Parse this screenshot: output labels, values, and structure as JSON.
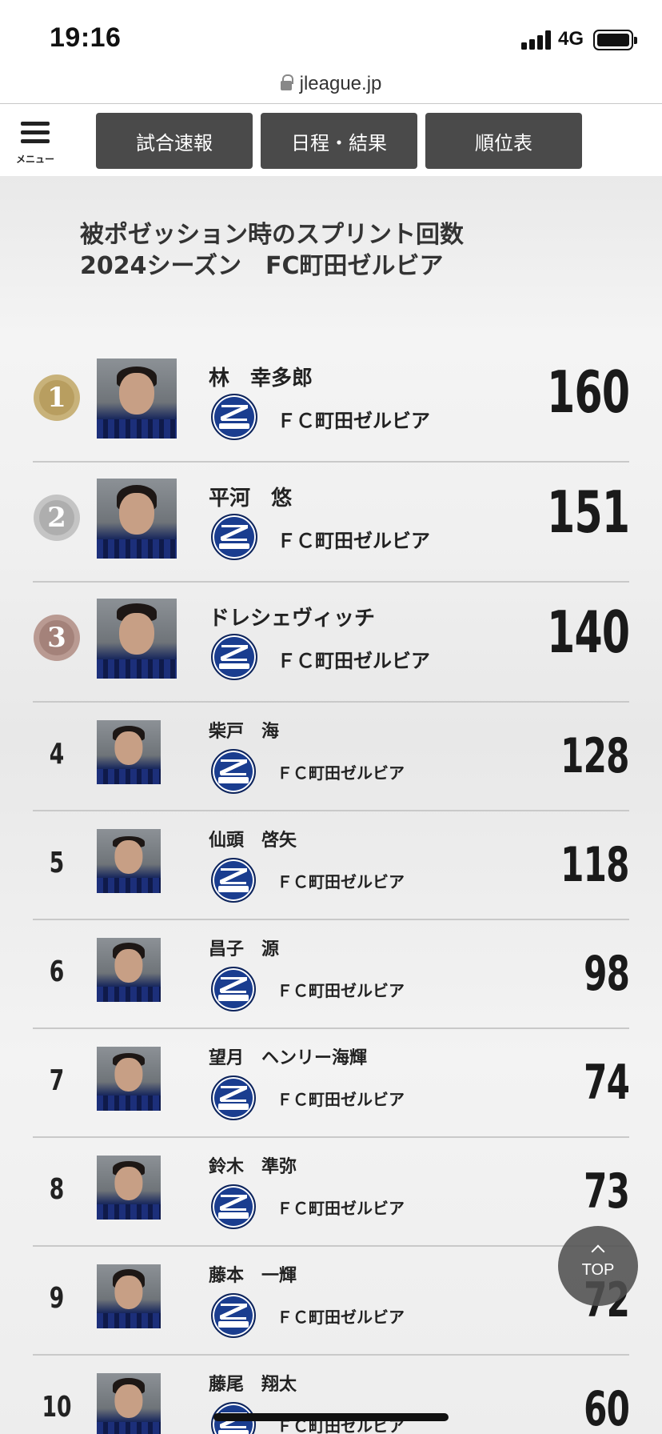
{
  "status_bar": {
    "time": "19:16",
    "network": "4G",
    "url": "jleague.jp"
  },
  "nav": {
    "menu_label": "メニュー",
    "tabs": [
      "試合速報",
      "日程・結果",
      "順位表"
    ]
  },
  "page": {
    "title_line1": "被ポゼッション時のスプリント回数",
    "title_line2": "2024シーズン　FC町田ゼルビア"
  },
  "rankings": [
    {
      "rank": "1",
      "name": "林　幸多郎",
      "club": "ＦＣ町田ゼルビア",
      "value": "160"
    },
    {
      "rank": "2",
      "name": "平河　悠",
      "club": "ＦＣ町田ゼルビア",
      "value": "151"
    },
    {
      "rank": "3",
      "name": "ドレシェヴィッチ",
      "club": "ＦＣ町田ゼルビア",
      "value": "140"
    },
    {
      "rank": "4",
      "name": "柴戸　海",
      "club": "ＦＣ町田ゼルビア",
      "value": "128"
    },
    {
      "rank": "5",
      "name": "仙頭　啓矢",
      "club": "ＦＣ町田ゼルビア",
      "value": "118"
    },
    {
      "rank": "6",
      "name": "昌子　源",
      "club": "ＦＣ町田ゼルビア",
      "value": "98"
    },
    {
      "rank": "7",
      "name": "望月　ヘンリー海輝",
      "club": "ＦＣ町田ゼルビア",
      "value": "74"
    },
    {
      "rank": "8",
      "name": "鈴木　準弥",
      "club": "ＦＣ町田ゼルビア",
      "value": "73"
    },
    {
      "rank": "9",
      "name": "藤本　一輝",
      "club": "ＦＣ町田ゼルビア",
      "value": "72"
    },
    {
      "rank": "10",
      "name": "藤尾　翔太",
      "club": "ＦＣ町田ゼルビア",
      "value": "60"
    }
  ],
  "top_button": {
    "label": "TOP"
  },
  "colors": {
    "gold": "#c8b27a",
    "silver": "#c4c4c4",
    "bronze": "#b99a92",
    "nav_tab_bg": "#4a4a4a",
    "club_blue": "#1a3d8f"
  }
}
